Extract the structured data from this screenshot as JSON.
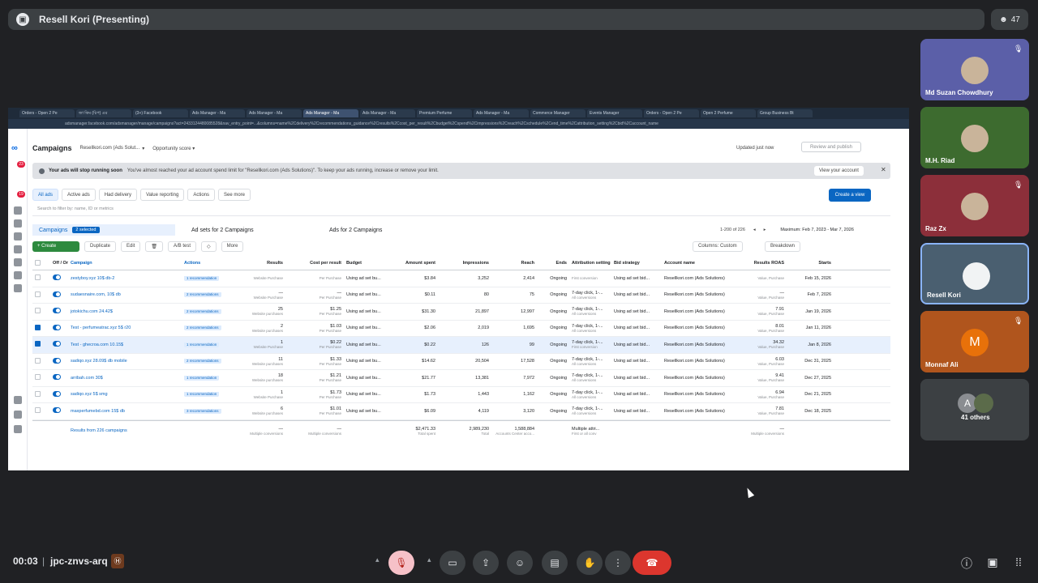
{
  "meeting": {
    "presenter_title": "Resell Kori (Presenting)",
    "participant_count": "47",
    "time": "00:03",
    "code": "jpc-znvs-arq"
  },
  "browser": {
    "tabs": [
      "Orders - Open 2 Pe",
      "জা কিম (চিপ) এর",
      "(3+) Facebook",
      "Ads Manager - Ma",
      "Ads Manager - Ma",
      "Ads Manager - Ma",
      "Ads Manager - Ma",
      "Premium Perfume",
      "Ads Manager - Ma",
      "Commerce Manager",
      "Events Manager",
      "Orders - Open 2 Pe",
      "Open 2 Perfume",
      "Group Business Bt"
    ],
    "active_tab": 5,
    "url": "adsmanager.facebook.com/adsmanager/manage/campaigns?act=2433124480085528&nav_entry_point=...&columns=name%2Cdelivery%2Crecommendations_guidance%2Cresults%2Ccost_per_result%2Cbudget%2Cspend%2Cimpressions%2Creach%2Cschedule%2Cend_time%2Cattribution_setting%2Cbid%2Caccount_name"
  },
  "ads": {
    "page_title": "Campaigns",
    "account": "Resellkori.com (Ads Solut...",
    "opportunity": "Opportunity score",
    "updated": "Updated just now",
    "review_btn": "Review and publish",
    "warning_bold": "Your ads will stop running soon",
    "warning_text": "You've almost reached your ad account spend limit for \"Resellkori.com (Ads Solutions)\". To keep your ads running, increase or remove your limit.",
    "view_account": "View your account",
    "filters": [
      "All ads",
      "Active ads",
      "Had delivery",
      "Value reporting",
      "Actions",
      "See more"
    ],
    "create_view": "Create a view",
    "search_placeholder": "Search to filter by: name, ID or metrics",
    "level_tabs": {
      "campaigns": "Campaigns",
      "selected": "2 selected",
      "adsets": "Ad sets for 2 Campaigns",
      "ads": "Ads for 2 Campaigns"
    },
    "paging": "1-200 of 226",
    "date_range": "Maximum: Feb 7, 2023 - Mar 7, 2026",
    "toolbar": {
      "create": "Create",
      "duplicate": "Duplicate",
      "edit": "Edit",
      "ab": "A/B test",
      "more": "More",
      "columns": "Columns: Custom",
      "breakdown": "Breakdown"
    },
    "columns": [
      "Off / On",
      "Campaign",
      "Actions",
      "Results",
      "Cost per result",
      "Budget",
      "Amount spent",
      "Impressions",
      "Reach",
      "Ends",
      "Attribution setting",
      "Bid strategy",
      "Account name",
      "Results ROAS",
      "Starts"
    ],
    "rows": [
      {
        "name": "zestyboy.xyz 10$ db-2",
        "rec": "1 recommendation",
        "results": "",
        "results_sub": "Website Purchase",
        "cpr": "",
        "cpr_sub": "Per Purchase",
        "budget": "Using ad set bu...",
        "spent": "$3.84",
        "impr": "3,252",
        "reach": "2,414",
        "ends": "Ongoing",
        "attr": "",
        "attr_sub": "First conversion",
        "bid": "Using ad set bid...",
        "acct": "Resellkori.com (Ads Solutions)",
        "roas": "",
        "roas_sub": "Value, Purchase",
        "starts": "Feb 15, 2026",
        "checked": false,
        "selected": false
      },
      {
        "name": "sudaesnaire.com, 10$ db",
        "rec": "2 recommendations",
        "results": "—",
        "results_sub": "Website Purchase",
        "cpr": "—",
        "cpr_sub": "Per Purchase",
        "budget": "Using ad set bu...",
        "spent": "$0.11",
        "impr": "80",
        "reach": "75",
        "ends": "Ongoing",
        "attr": "7-day click, 1-...",
        "attr_sub": "All conversions",
        "bid": "Using ad set bid...",
        "acct": "Resellkori.com (Ads Solutions)",
        "roas": "—",
        "roas_sub": "Value, Purchase",
        "starts": "Feb 7, 2026",
        "checked": false,
        "selected": false
      },
      {
        "name": "jotokichu.com 24.42$",
        "rec": "2 recommendations",
        "results": "25",
        "results_sub": "Website purchases",
        "cpr": "$1.25",
        "cpr_sub": "Per Purchase",
        "budget": "Using ad set bu...",
        "spent": "$31.30",
        "impr": "21,897",
        "reach": "12,997",
        "ends": "Ongoing",
        "attr": "7-day click, 1-...",
        "attr_sub": "All conversions",
        "bid": "Using ad set bid...",
        "acct": "Resellkori.com (Ads Solutions)",
        "roas": "7.91",
        "roas_sub": "Value, Purchase",
        "starts": "Jan 19, 2026",
        "checked": false,
        "selected": false
      },
      {
        "name": "Test - perfumeatrac.xyz 5$ r20",
        "rec": "2 recommendations",
        "results": "2",
        "results_sub": "Website purchases",
        "cpr": "$1.03",
        "cpr_sub": "Per Purchase",
        "budget": "Using ad set bu...",
        "spent": "$2.06",
        "impr": "2,019",
        "reach": "1,695",
        "ends": "Ongoing",
        "attr": "7-day click, 1-...",
        "attr_sub": "All conversions",
        "bid": "Using ad set bid...",
        "acct": "Resellkori.com (Ads Solutions)",
        "roas": "8.01",
        "roas_sub": "Value, Purchase",
        "starts": "Jan 11, 2026",
        "checked": true,
        "selected": false
      },
      {
        "name": "Test - ghecroa.com 10.15$",
        "rec": "1 recommendation",
        "results": "1",
        "results_sub": "Website Purchase",
        "cpr": "$0.22",
        "cpr_sub": "Per Purchase",
        "budget": "Using ad set bu...",
        "spent": "$0.22",
        "impr": "126",
        "reach": "99",
        "ends": "Ongoing",
        "attr": "7-day click, 1-...",
        "attr_sub": "First conversion",
        "bid": "Using ad set bid...",
        "acct": "Resellkori.com (Ads Solutions)",
        "roas": "34.32",
        "roas_sub": "Value, Purchase",
        "starts": "Jan 8, 2026",
        "checked": true,
        "selected": true
      },
      {
        "name": "sadiqo.xyz 28.09$ db mobile",
        "rec": "2 recommendations",
        "results": "11",
        "results_sub": "Website purchases",
        "cpr": "$1.33",
        "cpr_sub": "Per Purchase",
        "budget": "Using ad set bu...",
        "spent": "$14.62",
        "impr": "20,504",
        "reach": "17,528",
        "ends": "Ongoing",
        "attr": "7-day click, 1-...",
        "attr_sub": "All conversions",
        "bid": "Using ad set bid...",
        "acct": "Resellkori.com (Ads Solutions)",
        "roas": "6.03",
        "roas_sub": "Value, Purchase",
        "starts": "Dec 31, 2025",
        "checked": false,
        "selected": false
      },
      {
        "name": "arribah.com 30$",
        "rec": "1 recommendation",
        "results": "18",
        "results_sub": "Website purchases",
        "cpr": "$1.21",
        "cpr_sub": "Per Purchase",
        "budget": "Using ad set bu...",
        "spent": "$21.77",
        "impr": "13,381",
        "reach": "7,972",
        "ends": "Ongoing",
        "attr": "7-day click, 1-...",
        "attr_sub": "All conversions",
        "bid": "Using ad set bid...",
        "acct": "Resellkori.com (Ads Solutions)",
        "roas": "9.41",
        "roas_sub": "Value, Purchase",
        "starts": "Dec 27, 2025",
        "checked": false,
        "selected": false
      },
      {
        "name": "sadiqo.xyz 5$ smg",
        "rec": "1 recommendation",
        "results": "1",
        "results_sub": "Website Purchase",
        "cpr": "$1.73",
        "cpr_sub": "Per Purchase",
        "budget": "Using ad set bu...",
        "spent": "$1.73",
        "impr": "1,443",
        "reach": "1,162",
        "ends": "Ongoing",
        "attr": "7-day click, 1-...",
        "attr_sub": "All conversions",
        "bid": "Using ad set bid...",
        "acct": "Resellkori.com (Ads Solutions)",
        "roas": "6.94",
        "roas_sub": "Value, Purchase",
        "starts": "Dec 21, 2025",
        "checked": false,
        "selected": false
      },
      {
        "name": "maxperfumebd.com 15$ db",
        "rec": "3 recommendations",
        "results": "6",
        "results_sub": "Website purchases",
        "cpr": "$1.01",
        "cpr_sub": "Per Purchase",
        "budget": "Using ad set bu...",
        "spent": "$6.09",
        "impr": "4,119",
        "reach": "3,120",
        "ends": "Ongoing",
        "attr": "7-day click, 1-...",
        "attr_sub": "All conversions",
        "bid": "Using ad set bid...",
        "acct": "Resellkori.com (Ads Solutions)",
        "roas": "7.81",
        "roas_sub": "Value, Purchase",
        "starts": "Dec 18, 2025",
        "checked": false,
        "selected": false
      }
    ],
    "footer": {
      "label": "Results from 226 campaigns",
      "results": "—",
      "results_sub": "Multiple conversions",
      "cpr": "—",
      "cpr_sub": "Multiple conversions",
      "spent": "$2,471.33",
      "spent_sub": "Total spent",
      "impr": "2,989,230",
      "impr_sub": "Total",
      "reach": "1,588,884",
      "reach_sub": "Accounts Center acco...",
      "attr": "Multiple attri...",
      "attr_sub": "First or all conv",
      "roas": "—",
      "roas_sub": "Multiple conversions"
    }
  },
  "participants": [
    {
      "name": "Md Suzan Chowdhury",
      "bg": "#5b5fa8",
      "muted": true
    },
    {
      "name": "M.H. Riad",
      "bg": "#3d6b2f",
      "muted": false
    },
    {
      "name": "Raz Zx",
      "bg": "#8c2f3a",
      "muted": true
    },
    {
      "name": "Resell Kori",
      "bg": "#4a5f70",
      "muted": false
    },
    {
      "name": "Monnaf Ali",
      "bg": "#b0551d",
      "muted": true,
      "initial": "M"
    },
    {
      "name": "41 others",
      "bg": "#3c4043",
      "muted": false,
      "initial": "A"
    }
  ]
}
